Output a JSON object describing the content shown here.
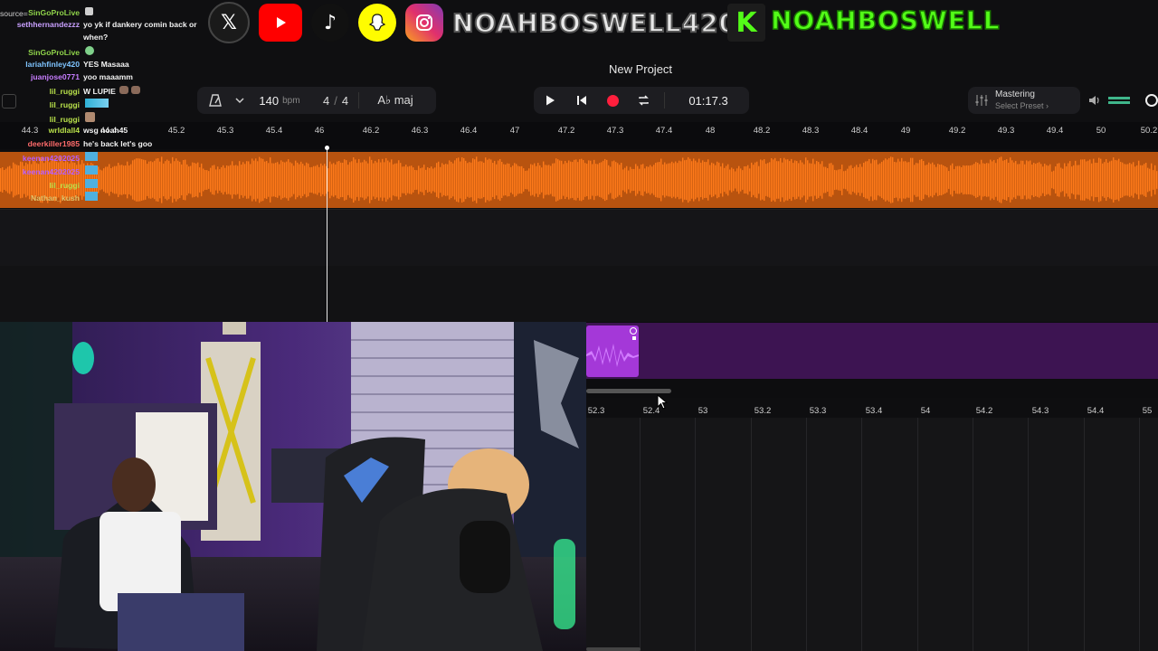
{
  "overlay": {
    "social_icons": [
      "x-icon",
      "youtube-icon",
      "tiktok-icon",
      "snapchat-icon",
      "instagram-icon"
    ],
    "handle_primary": "NOAHBOSWELL420",
    "kick_letter": "K",
    "handle_kick": "NOAHBOSWELL",
    "brand_green": "#53fc18"
  },
  "chat": {
    "partial_top": "source=",
    "messages": [
      {
        "user": "SinGoProLive",
        "text": "",
        "color": "#8fd34a"
      },
      {
        "user": "sethhernandezzz",
        "text": "yo yk if dankery comin back or",
        "color": "#c9a0ff"
      },
      {
        "user": "",
        "text": "when?",
        "color": "#ffffff"
      },
      {
        "user": "SinGoProLive",
        "text": "",
        "color": "#8fd34a"
      },
      {
        "user": "lariahfinley420",
        "text": "YES Masaaa",
        "color": "#7fc4ff"
      },
      {
        "user": "juanjose0771",
        "text": "yoo maaamm",
        "color": "#c77dff"
      },
      {
        "user": "lil_ruggi",
        "text": "W LUPIE",
        "color": "#b8e04a"
      },
      {
        "user": "lil_ruggi",
        "text": "",
        "color": "#b8e04a"
      },
      {
        "user": "lil_ruggi",
        "text": "",
        "color": "#b8e04a"
      },
      {
        "user": "wrldlall4",
        "text": "wsg noah45",
        "color": "#b8e04a"
      },
      {
        "user": "deerkiller1985",
        "text": "he's back let's goo",
        "color": "#ff6b6b"
      },
      {
        "user": "keenan4202025",
        "text": "",
        "color": "#b45cff"
      },
      {
        "user": "keenan4202025",
        "text": "",
        "color": "#b45cff"
      },
      {
        "user": "lil_ruggi",
        "text": "",
        "color": "#b8e04a"
      },
      {
        "user": "Nathan_kush",
        "text": "",
        "color": "#e0c36a"
      }
    ]
  },
  "daw": {
    "project_title": "New Project",
    "tempo_value": "140",
    "tempo_unit": "bpm",
    "time_sig_num": "4",
    "time_sig_sep": "/",
    "time_sig_den": "4",
    "key_label": "A♭ maj",
    "time_display": "01:17.3",
    "mastering_label": "Mastering",
    "mastering_preset": "Select Preset ›",
    "volume_level": 0.55,
    "colors": {
      "audio_clip": "#e8690f",
      "midi_clip": "#a438d8",
      "record": "#ff1f3d"
    }
  },
  "ruler_top": [
    "44.3",
    "44.4",
    "45",
    "45.2",
    "45.3",
    "45.4",
    "46",
    "46.2",
    "46.3",
    "46.4",
    "47",
    "47.2",
    "47.3",
    "47.4",
    "48",
    "48.2",
    "48.3",
    "48.4",
    "49",
    "49.2",
    "49.3",
    "49.4",
    "50",
    "50.2"
  ],
  "ruler_bottom": [
    "52.3",
    "52.4",
    "53",
    "53.2",
    "53.3",
    "53.4",
    "54",
    "54.2",
    "54.3",
    "54.4",
    "55"
  ]
}
